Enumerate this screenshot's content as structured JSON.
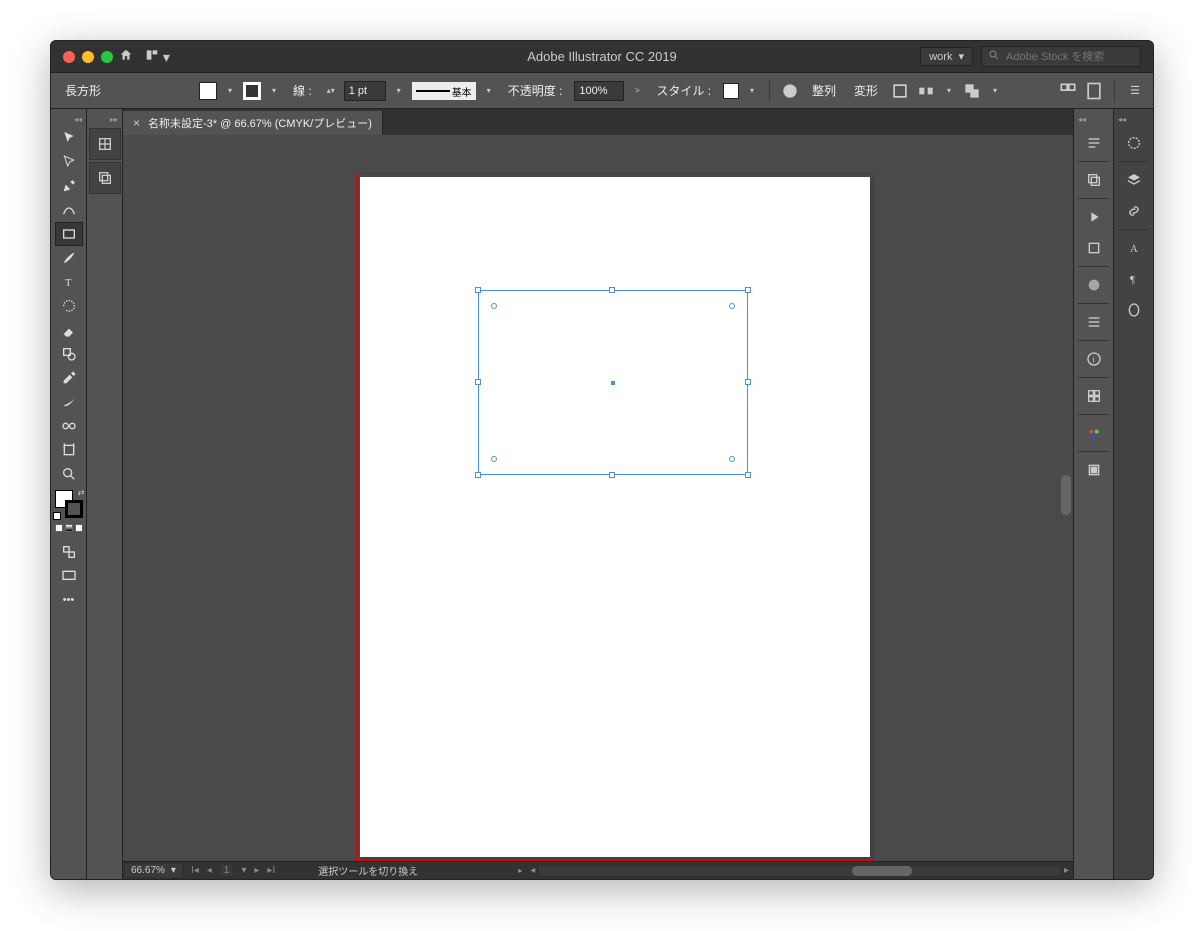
{
  "app": {
    "title": "Adobe Illustrator CC 2019"
  },
  "titlebar": {
    "workspace_label": "work",
    "search_placeholder": "Adobe Stock を検索"
  },
  "control_bar": {
    "shape_label": "長方形",
    "stroke_label": "線 :",
    "stroke_weight": "1 pt",
    "stroke_preset": "基本",
    "opacity_label": "不透明度 :",
    "opacity_value": "100%",
    "style_label": "スタイル :",
    "align_label": "整列",
    "transform_label": "変形"
  },
  "document": {
    "tab_title": "名称未設定-3* @ 66.67% (CMYK/プレビュー)"
  },
  "status": {
    "zoom": "66.67%",
    "artboard_index": "1",
    "hint": "選択ツールを切り換え"
  },
  "tools": [
    "selection",
    "direct-selection",
    "pen",
    "curvature",
    "type",
    "line",
    "rectangle",
    "paintbrush",
    "shape-builder",
    "eyedropper",
    "gradient",
    "blend",
    "symbol-sprayer",
    "artboard",
    "zoom"
  ],
  "right_a": [
    "properties",
    "libraries",
    "actions",
    "artboards",
    "navigator",
    "align",
    "css",
    "info",
    "color-guide",
    "swatches",
    "appearance"
  ],
  "right_b": [
    "color",
    "layers",
    "links",
    "type-panel",
    "paragraph",
    "glyphs"
  ]
}
